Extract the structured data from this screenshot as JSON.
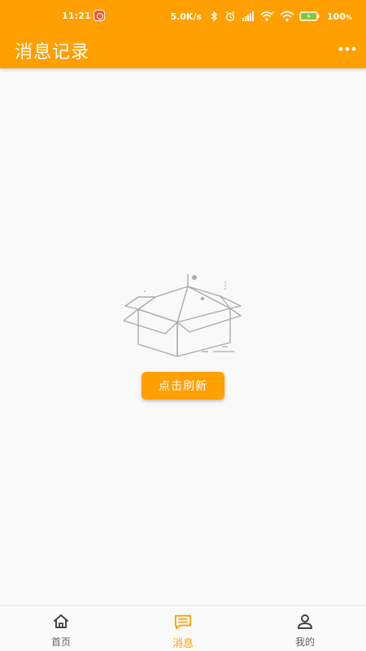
{
  "status_bar": {
    "time": "11:21",
    "network_speed": "5.0K/s",
    "battery": "100"
  },
  "header": {
    "title": "消息记录",
    "more_icon": "more-horizontal-icon"
  },
  "empty_state": {
    "illustration": "empty-box-icon",
    "refresh_label": "点击刷新"
  },
  "bottom_nav": {
    "items": [
      {
        "label": "首页",
        "icon": "home-icon",
        "active": false
      },
      {
        "label": "消息",
        "icon": "message-icon",
        "active": true
      },
      {
        "label": "我的",
        "icon": "user-icon",
        "active": false
      }
    ]
  },
  "colors": {
    "accent": "#ff9f00",
    "background": "#f9f9f9",
    "inactive_nav": "#666666"
  }
}
